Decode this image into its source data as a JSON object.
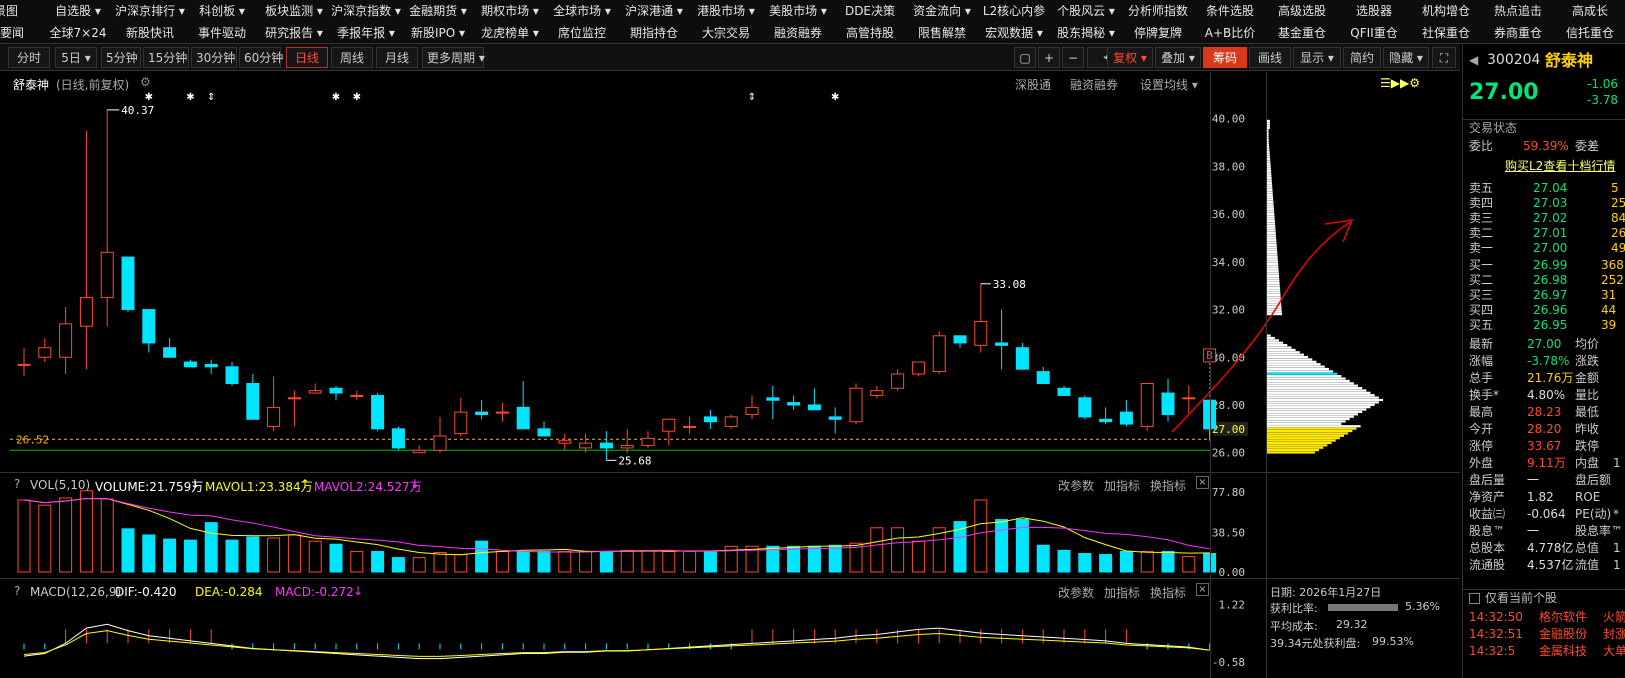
{
  "menu_row1": [
    "景图",
    "自选股 ▾",
    "沪深京排行 ▾",
    "科创板 ▾",
    "板块监测 ▾",
    "沪深京指数 ▾",
    "金融期货 ▾",
    "期权市场 ▾",
    "全球市场 ▾",
    "沪深港通 ▾",
    "港股市场 ▾",
    "美股市场 ▾",
    "DDE决策",
    "资金流向 ▾",
    "L2核心内参",
    "个股风云 ▾",
    "分析师指数",
    "条件选股",
    "高级选股",
    "选股器",
    "机构增仓",
    "热点追击",
    "高成长"
  ],
  "menu_row2": [
    "经要闻",
    "全球7×24",
    "新股快讯",
    "事件驱动",
    "研究报告 ▾",
    "季报年报 ▾",
    "新股IPO ▾",
    "龙虎榜单 ▾",
    "席位监控",
    "期指持仓",
    "大宗交易",
    "融资融券",
    "高管持股",
    "限售解禁",
    "宏观数据 ▾",
    "股东揭秘 ▾",
    "停牌复牌",
    "A+B比价",
    "基金重仓",
    "QFII重仓",
    "社保重仓",
    "券商重仓",
    "信托重仓"
  ],
  "toolbar_left": [
    "分时",
    "5日 ▾",
    "5分钟",
    "15分钟",
    "30分钟",
    "60分钟",
    "日线",
    "周线",
    "月线",
    "更多周期 ▾"
  ],
  "toolbar_right": [
    "复权 ▾",
    "叠加 ▾",
    "筹码",
    "画线",
    "显示 ▾",
    "简约",
    "隐藏 ▾"
  ],
  "stock": {
    "name": "舒泰神",
    "code": "300204",
    "mode": "(日线,前复权)",
    "price": "27.00",
    "chg": "-1.06",
    "pct": "-3.78"
  },
  "chart_links": [
    "深股通",
    "融资融券",
    "设置均线 ▾"
  ],
  "annotations": {
    "high": "40.37",
    "mid": "33.08",
    "low": "25.68",
    "cur": "26.52",
    "b": "B"
  },
  "price_axis": [
    "40.00",
    "38.00",
    "36.00",
    "34.00",
    "32.00",
    "30.00",
    "28.00",
    "27.00",
    "26.00"
  ],
  "vol_axis": [
    "77.80",
    "38.50",
    "0.00"
  ],
  "macd_axis": [
    "1.22",
    "-0.58"
  ],
  "vol_title": {
    "q": "?",
    "name": "VOL(5,10)",
    "vol": "VOLUME:21.759万",
    "m1": "MAVOL1:23.384万",
    "m2": "MAVOL2:24.527万",
    "arrow": "↓",
    "arrow_up": "↑"
  },
  "macd_title": {
    "q": "?",
    "name": "MACD(12,26,9)",
    "dif": "DIF:-0.420",
    "dea": "DEA:-0.284",
    "macd": "MACD:-0.272",
    "arrow": "↓"
  },
  "ind_links": [
    "改参数",
    "加指标",
    "换指标"
  ],
  "chip": {
    "date": "日期: 2026年1月27日",
    "profit_label": "获利比率:",
    "profit": "5.36%",
    "avg_label": "平均成本:",
    "avg": "29.32",
    "bottom": "39.34元处获利盘:",
    "bottom_val": "99.53%"
  },
  "rp": {
    "state": "交易状态",
    "weibi_l": "委比",
    "weibi": "59.39%",
    "weicha": "委差",
    "buy_l2": "购买L2查看十档行情",
    "sells": [
      [
        "卖五",
        "27.04",
        "5"
      ],
      [
        "卖四",
        "27.03",
        "25"
      ],
      [
        "卖三",
        "27.02",
        "84"
      ],
      [
        "卖二",
        "27.01",
        "26"
      ],
      [
        "卖一",
        "27.00",
        "49"
      ]
    ],
    "buys": [
      [
        "买一",
        "26.99",
        "368"
      ],
      [
        "买二",
        "26.98",
        "252"
      ],
      [
        "买三",
        "26.97",
        "31"
      ],
      [
        "买四",
        "26.96",
        "44"
      ],
      [
        "买五",
        "26.95",
        "39"
      ]
    ],
    "stats": [
      [
        "最新",
        "27.00",
        "均价",
        ""
      ],
      [
        "涨幅",
        "-3.78%",
        "涨跌",
        ""
      ],
      [
        "总手",
        "21.76万",
        "金额",
        ""
      ],
      [
        "换手*",
        "4.80%",
        "量比",
        ""
      ],
      [
        "最高",
        "28.23",
        "最低",
        ""
      ],
      [
        "今开",
        "28.20",
        "昨收",
        ""
      ],
      [
        "涨停",
        "33.67",
        "跌停",
        ""
      ],
      [
        "外盘",
        "9.11万",
        "内盘",
        "1"
      ],
      [
        "盘后量",
        "一",
        "盘后额",
        ""
      ],
      [
        "净资产",
        "1.82",
        "ROE",
        ""
      ],
      [
        "收益㈢",
        "-0.064",
        "PE(动)",
        "*"
      ],
      [
        "股息™",
        "一",
        "股息率™",
        ""
      ],
      [
        "总股本",
        "4.778亿",
        "总值",
        "1"
      ],
      [
        "流通股",
        "4.537亿",
        "流值",
        "1"
      ]
    ],
    "only_current": "仅看当前个股",
    "ticks": [
      [
        "14:32:50",
        "格尔软件",
        "火箭"
      ],
      [
        "14:32:51",
        "金融股份",
        "封涨"
      ],
      [
        "14:32:5",
        "金属科技",
        "大单"
      ]
    ]
  },
  "chart_data": {
    "type": "candlestick",
    "title": "舒泰神 (日线,前复权)",
    "yrange": [
      25.4,
      40.7
    ],
    "candles": [
      [
        29.7,
        30.4,
        29.2,
        29.7
      ],
      [
        30.0,
        30.8,
        29.8,
        30.4
      ],
      [
        30.0,
        32.1,
        29.3,
        31.4
      ],
      [
        31.3,
        39.5,
        29.5,
        32.5
      ],
      [
        32.5,
        40.37,
        31.3,
        34.4
      ],
      [
        34.2,
        33.6,
        31.9,
        32.0
      ],
      [
        32.0,
        31.3,
        30.2,
        30.6
      ],
      [
        30.4,
        30.8,
        30.0,
        30.0
      ],
      [
        29.8,
        29.9,
        29.6,
        29.6
      ],
      [
        29.7,
        29.9,
        29.3,
        29.6
      ],
      [
        29.6,
        29.8,
        28.8,
        28.9
      ],
      [
        28.9,
        29.3,
        27.4,
        27.4
      ],
      [
        27.1,
        29.2,
        26.9,
        27.9
      ],
      [
        28.3,
        28.6,
        27.1,
        28.3
      ],
      [
        28.5,
        28.9,
        28.5,
        28.6
      ],
      [
        28.7,
        28.8,
        28.2,
        28.5
      ],
      [
        28.4,
        28.6,
        28.2,
        28.4
      ],
      [
        28.4,
        28.5,
        26.9,
        27.0
      ],
      [
        27.0,
        27.1,
        26.1,
        26.2
      ],
      [
        26.0,
        26.3,
        26.1,
        26.1
      ],
      [
        26.1,
        27.5,
        26.0,
        26.7
      ],
      [
        26.8,
        28.3,
        26.7,
        27.7
      ],
      [
        27.7,
        28.2,
        27.4,
        27.6
      ],
      [
        27.7,
        28.1,
        27.3,
        27.7
      ],
      [
        27.9,
        29.0,
        27.1,
        27.0
      ],
      [
        27.0,
        27.3,
        26.7,
        26.7
      ],
      [
        26.4,
        26.8,
        26.1,
        26.5
      ],
      [
        26.2,
        26.8,
        26.0,
        26.4
      ],
      [
        26.4,
        26.9,
        25.68,
        26.2
      ],
      [
        26.2,
        27.0,
        26.0,
        26.3
      ],
      [
        26.3,
        26.9,
        26.2,
        26.6
      ],
      [
        26.9,
        27.2,
        26.3,
        27.4
      ],
      [
        27.1,
        27.5,
        26.8,
        27.1
      ],
      [
        27.5,
        27.8,
        27.0,
        27.3
      ],
      [
        27.1,
        27.6,
        27.0,
        27.5
      ],
      [
        27.6,
        28.4,
        27.4,
        27.9
      ],
      [
        28.3,
        28.8,
        27.4,
        28.2
      ],
      [
        28.1,
        28.4,
        27.8,
        28.0
      ],
      [
        28.0,
        28.7,
        27.9,
        27.8
      ],
      [
        27.5,
        27.9,
        26.8,
        27.4
      ],
      [
        27.3,
        28.9,
        27.2,
        28.7
      ],
      [
        28.4,
        28.8,
        28.3,
        28.6
      ],
      [
        28.7,
        29.5,
        28.6,
        29.3
      ],
      [
        29.3,
        29.7,
        29.2,
        29.8
      ],
      [
        29.4,
        31.1,
        29.3,
        30.9
      ],
      [
        30.9,
        30.9,
        30.4,
        30.6
      ],
      [
        30.5,
        33.08,
        30.2,
        31.5
      ],
      [
        30.6,
        32.0,
        29.5,
        30.5
      ],
      [
        30.4,
        30.6,
        29.5,
        29.5
      ],
      [
        29.4,
        29.6,
        28.9,
        28.9
      ],
      [
        28.7,
        28.8,
        28.5,
        28.4
      ],
      [
        28.3,
        28.4,
        27.4,
        27.5
      ],
      [
        27.4,
        27.9,
        27.2,
        27.3
      ],
      [
        27.7,
        28.2,
        27.1,
        27.2
      ],
      [
        27.1,
        27.2,
        26.9,
        28.9
      ],
      [
        28.5,
        29.1,
        27.3,
        27.6
      ],
      [
        28.3,
        28.8,
        27.6,
        28.3
      ],
      [
        28.2,
        28.23,
        26.5,
        27.0
      ]
    ],
    "volume": [
      70,
      65,
      72,
      79,
      71,
      42,
      36,
      32,
      31,
      48,
      31,
      34,
      33,
      36,
      30,
      27,
      20,
      20,
      14,
      14,
      19,
      17,
      30,
      20,
      20,
      20,
      20,
      20,
      20,
      21,
      21,
      20,
      20,
      20,
      25,
      25,
      25,
      25,
      25,
      26,
      28,
      43,
      43,
      30,
      43,
      49,
      70,
      51,
      51,
      26,
      21,
      18,
      17,
      20,
      20,
      20,
      15,
      18
    ],
    "macd": [
      -0.5,
      -0.4,
      0.0,
      0.6,
      0.75,
      0.5,
      0.3,
      0.2,
      0.1,
      0.0,
      -0.1,
      -0.2,
      -0.25,
      -0.3,
      -0.35,
      -0.4,
      -0.45,
      -0.5,
      -0.55,
      -0.6,
      -0.6,
      -0.55,
      -0.5,
      -0.45,
      -0.4,
      -0.4,
      -0.35,
      -0.35,
      -0.3,
      -0.3,
      -0.25,
      -0.2,
      -0.15,
      -0.1,
      -0.05,
      0.0,
      0.05,
      0.1,
      0.15,
      0.2,
      0.3,
      0.35,
      0.45,
      0.55,
      0.6,
      0.5,
      0.4,
      0.35,
      0.3,
      0.25,
      0.2,
      0.15,
      0.1,
      0.0,
      -0.05,
      -0.1,
      -0.15,
      -0.27
    ]
  },
  "colors": {
    "up": "#ff4a2a",
    "down": "#00e5ff",
    "bg": "#000000"
  }
}
